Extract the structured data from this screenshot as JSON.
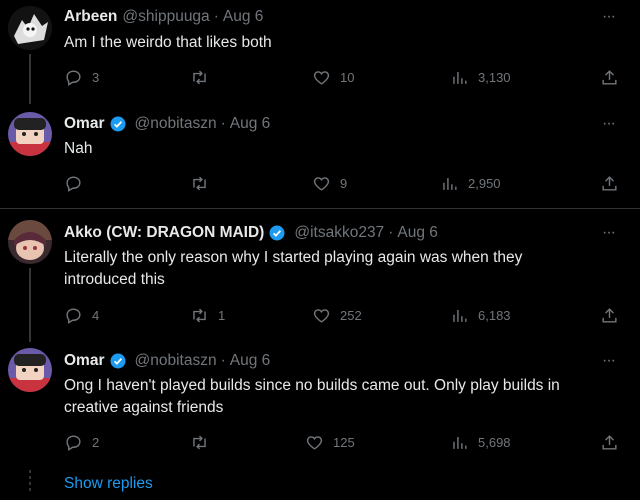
{
  "tweets": [
    {
      "name": "Arbeen",
      "handle": "@shippuuga",
      "date": "Aug 6",
      "verified": false,
      "text_lines": [
        "Am I the weirdo that likes both"
      ],
      "replies": "3",
      "retweets": "",
      "likes": "10",
      "views": "3,130"
    },
    {
      "name": "Omar",
      "handle": "@nobitaszn",
      "date": "Aug 6",
      "verified": true,
      "text_lines": [
        "Nah"
      ],
      "replies": "",
      "retweets": "",
      "likes": "9",
      "views": "2,950"
    },
    {
      "name": "Akko (CW: DRAGON MAID)",
      "handle": "@itsakko237",
      "date": "Aug 6",
      "verified": true,
      "text_lines": [
        "Literally the only reason why I started playing again was when they",
        "introduced this"
      ],
      "replies": "4",
      "retweets": "1",
      "likes": "252",
      "views": "6,183"
    },
    {
      "name": "Omar",
      "handle": "@nobitaszn",
      "date": "Aug 6",
      "verified": true,
      "text_lines": [
        "Ong I haven't played builds since no builds came out. Only play builds in",
        "creative against friends"
      ],
      "replies": "2",
      "retweets": "",
      "likes": "125",
      "views": "5,698"
    }
  ],
  "separator": "·",
  "more_label": "···",
  "show_replies_label": "Show replies",
  "icons": {
    "reply": "reply-icon",
    "retweet": "retweet-icon",
    "like": "heart-icon",
    "views": "views-icon",
    "share": "share-icon",
    "verified": "verified-badge-icon",
    "more": "more-icon"
  },
  "colors": {
    "background": "#000000",
    "text": "#e7e9ea",
    "muted": "#71767b",
    "accent": "#1d9bf0",
    "divider": "#2f3336"
  }
}
